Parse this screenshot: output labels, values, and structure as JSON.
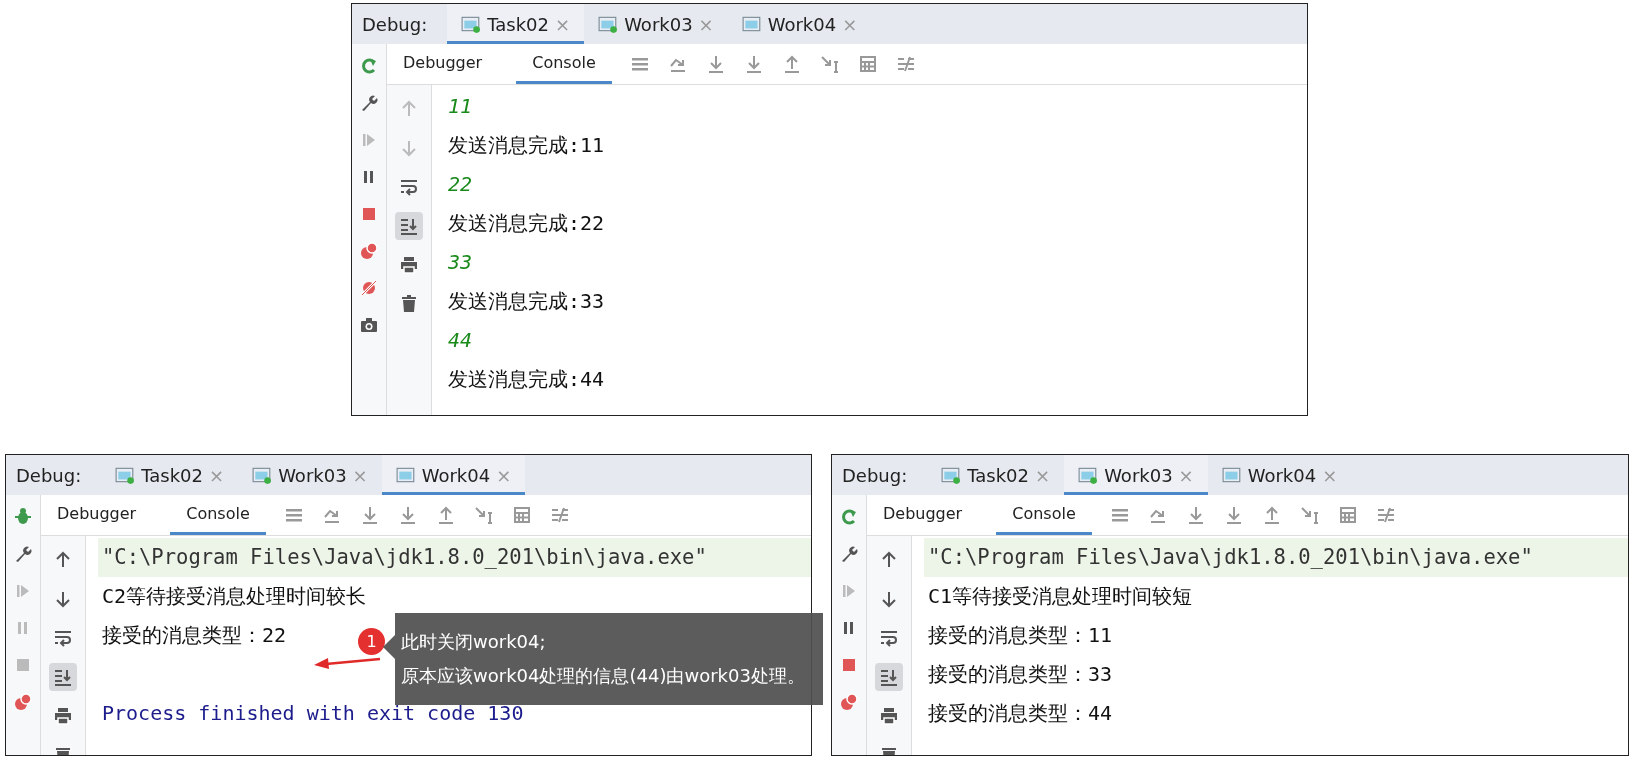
{
  "panels": [
    {
      "title": "Debug:",
      "finished": false,
      "tabs": [
        {
          "label": "Task02",
          "running": true,
          "selected": true
        },
        {
          "label": "Work03",
          "running": true,
          "selected": false
        },
        {
          "label": "Work04",
          "running": false,
          "selected": false
        }
      ],
      "close": "×",
      "views": [
        {
          "label": "Debugger",
          "selected": false
        },
        {
          "label": "Console",
          "selected": true
        }
      ],
      "lines": [
        {
          "kind": "number",
          "text": "11"
        },
        {
          "kind": "text",
          "text": "发送消息完成:11"
        },
        {
          "kind": "number",
          "text": "22"
        },
        {
          "kind": "text",
          "text": "发送消息完成:22"
        },
        {
          "kind": "number",
          "text": "33"
        },
        {
          "kind": "text",
          "text": "发送消息完成:33"
        },
        {
          "kind": "number",
          "text": "44"
        },
        {
          "kind": "text",
          "text": "发送消息完成:44"
        }
      ]
    },
    {
      "title": "Debug:",
      "finished": true,
      "tabs": [
        {
          "label": "Task02",
          "running": true,
          "selected": false
        },
        {
          "label": "Work03",
          "running": true,
          "selected": false
        },
        {
          "label": "Work04",
          "running": false,
          "selected": true
        }
      ],
      "close": "×",
      "views": [
        {
          "label": "Debugger",
          "selected": false
        },
        {
          "label": "Console",
          "selected": true
        }
      ],
      "lines": [
        {
          "kind": "command",
          "text": "\"C:\\Program Files\\Java\\jdk1.8.0_201\\bin\\java.exe\""
        },
        {
          "kind": "text",
          "text": "C2等待接受消息处理时间较长"
        },
        {
          "kind": "text",
          "text": "接受的消息类型：22"
        },
        {
          "kind": "exit",
          "text": "Process finished with exit code 130"
        }
      ]
    },
    {
      "title": "Debug:",
      "finished": false,
      "tabs": [
        {
          "label": "Task02",
          "running": true,
          "selected": false
        },
        {
          "label": "Work03",
          "running": true,
          "selected": true
        },
        {
          "label": "Work04",
          "running": false,
          "selected": false
        }
      ],
      "close": "×",
      "views": [
        {
          "label": "Debugger",
          "selected": false
        },
        {
          "label": "Console",
          "selected": true
        }
      ],
      "lines": [
        {
          "kind": "command",
          "text": "\"C:\\Program Files\\Java\\jdk1.8.0_201\\bin\\java.exe\""
        },
        {
          "kind": "text",
          "text": "C1等待接受消息处理时间较短"
        },
        {
          "kind": "text",
          "text": "接受的消息类型：11"
        },
        {
          "kind": "text",
          "text": "接受的消息类型：33"
        },
        {
          "kind": "text",
          "text": "接受的消息类型：44"
        }
      ]
    }
  ],
  "annotation": {
    "badge": "1",
    "lines": [
      "此时关闭work04;",
      "原本应该work04处理的信息(44)由work03处理。"
    ]
  }
}
